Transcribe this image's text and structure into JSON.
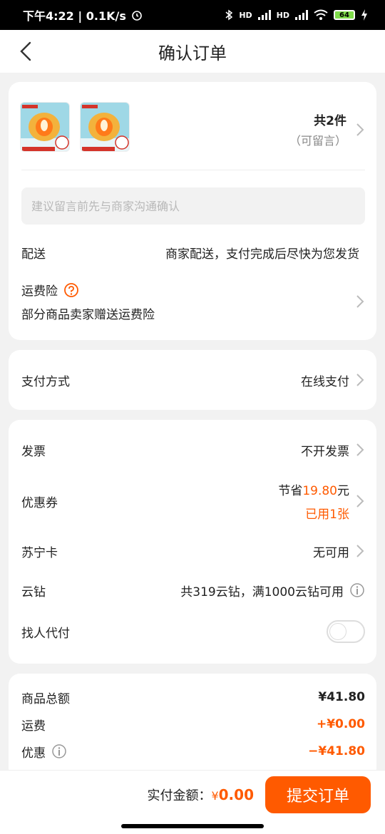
{
  "status_bar": {
    "time_speed": "下午4:22 | 0.1K/s",
    "hd1": "HD",
    "hd2": "HD",
    "battery": "64"
  },
  "header": {
    "title": "确认订单"
  },
  "order": {
    "count_label": "共2件",
    "count_sub": "（可留言）",
    "note_placeholder": "建议留言前先与商家沟通确认",
    "delivery_label": "配送",
    "delivery_value": "商家配送，支付完成后尽快为您发货",
    "insurance_label": "运费险",
    "insurance_desc": "部分商品卖家赠送运费险"
  },
  "payment": {
    "label": "支付方式",
    "value": "在线支付"
  },
  "options": {
    "invoice_label": "发票",
    "invoice_value": "不开发票",
    "coupon_label": "优惠券",
    "coupon_save_prefix": "节省",
    "coupon_save_amount": "19.80",
    "coupon_save_suffix": "元",
    "coupon_used": "已用1张",
    "suning_card_label": "苏宁卡",
    "suning_card_value": "无可用",
    "diamond_label": "云钻",
    "diamond_value": "共319云钻，满1000云钻可用",
    "pay_for_me_label": "找人代付"
  },
  "summary": {
    "goods_total_label": "商品总额",
    "goods_total_value": "¥41.80",
    "shipping_label": "运费",
    "shipping_value": "+¥0.00",
    "discount_label": "优惠",
    "discount_value": "−¥41.80"
  },
  "footer": {
    "pay_label": "实付金额：",
    "currency": "¥",
    "pay_amount": "0.00",
    "submit_label": "提交订单"
  },
  "colors": {
    "accent": "#ff5a00",
    "background": "#f2f2f2"
  }
}
